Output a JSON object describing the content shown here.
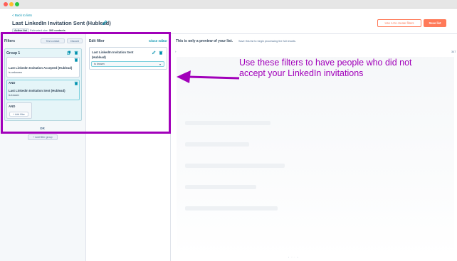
{
  "header": {
    "back_link": "< Back to lists",
    "title": "Last LinkedIn Invitation Sent (Hublead)",
    "status_badge": "Active list",
    "estimated_label": "Estimated size:",
    "estimated_value": "305 contacts",
    "ai_button": "Use AI to create filters",
    "save_button": "Save list"
  },
  "filters_panel": {
    "heading": "Filters",
    "test_contact": "Test contact",
    "discard": "Discard",
    "group_title": "Group 1",
    "filters": [
      {
        "title": "Last LinkedIn Invitation Accepted (Hublead)",
        "condition": "is unknown"
      },
      {
        "title": "Last LinkedIn Invitation Sent (Hublead)",
        "condition": "is known"
      }
    ],
    "and_label_1": "AND",
    "and_label_2": "AND",
    "add_filter": "+ Add filter",
    "or_label": "OR",
    "add_filter_group": "+ Add filter group"
  },
  "edit_panel": {
    "heading": "Edit filter",
    "close_editor": "Close editor",
    "property_line1": "Last LinkedIn Invitation Sent",
    "property_line2": "(Hublead)",
    "operator": "is known"
  },
  "preview_panel": {
    "title": "This is only a preview of your list.",
    "subtitle": "Save this list to begin processing the full results.",
    "column_number": "347"
  },
  "annotation": {
    "text": "Use these filters to have people who did not accept your LinkedIn invitations"
  },
  "colors": {
    "accent": "#ff7a59",
    "link": "#0091ae",
    "annotation": "#a100ba",
    "text": "#33475b"
  }
}
